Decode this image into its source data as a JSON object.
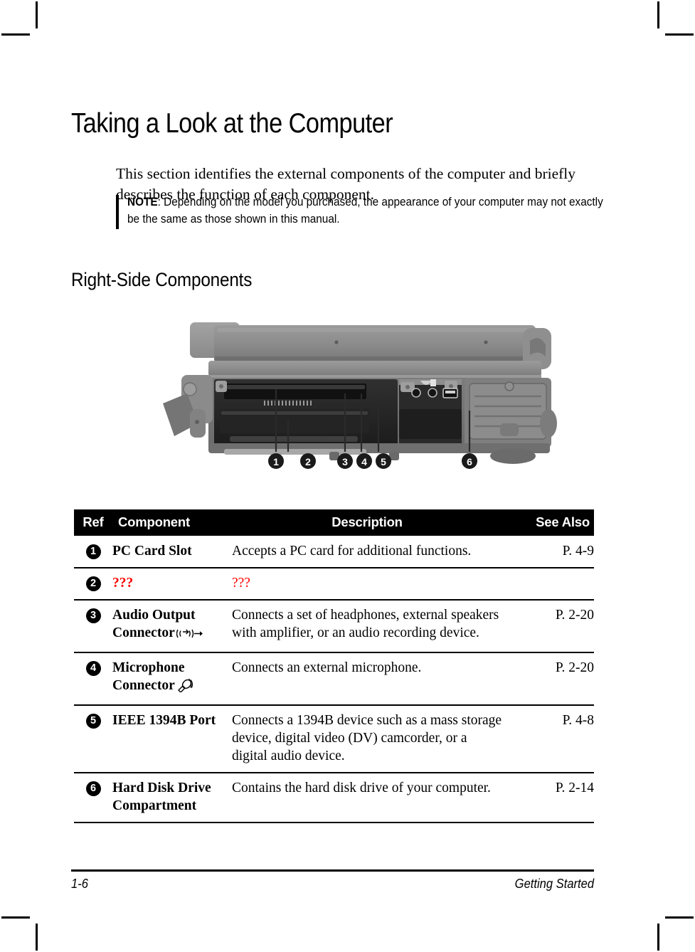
{
  "document": {
    "heading": "Taking a Look at the Computer",
    "intro": "This section identifies the external components of the computer and briefly describes the function of each component.",
    "note": {
      "label": "NOTE",
      "text": ": Depending on the model you purchased, the appearance of your computer may not exactly be the same as those shown in this manual."
    },
    "section_heading": "Right-Side Components"
  },
  "figure": {
    "alt": "Right-side view of a rugged notebook computer showing PC card slot, audio output connector, microphone connector, IEEE 1394B port and hard disk drive compartment",
    "callouts": [
      "1",
      "2",
      "3",
      "4",
      "5",
      "6"
    ],
    "body_color": "#8a8a8a",
    "shadow_color": "#5e5e5e",
    "dark_color": "#2e2e2e"
  },
  "table": {
    "headers": {
      "ref": "Ref",
      "component": "Component",
      "description": "Description",
      "see_also": "See Also"
    },
    "rows": [
      {
        "ref": "1",
        "component": "PC Card Slot",
        "icon": "",
        "description": "Accepts a PC card for additional functions.",
        "see_also": "P. 4-9",
        "missing": false
      },
      {
        "ref": "2",
        "component": "???",
        "icon": "",
        "description": "???",
        "see_also": "",
        "missing": true
      },
      {
        "ref": "3",
        "component": "Audio Output Connector",
        "icon": "audio-output-icon",
        "description": "Connects a set of headphones, external speakers with amplifier, or an audio recording device.",
        "see_also": "P. 2-20",
        "missing": false
      },
      {
        "ref": "4",
        "component": "Microphone Connector",
        "icon": "microphone-icon",
        "description": "Connects an external microphone.",
        "see_also": "P. 2-20",
        "missing": false
      },
      {
        "ref": "5",
        "component": "IEEE 1394B Port",
        "icon": "",
        "description": "Connects a 1394B device such as a mass storage device, digital video (DV) camcorder, or a digital audio device.",
        "see_also": "P. 4-8",
        "missing": false
      },
      {
        "ref": "6",
        "component": "Hard Disk Drive Compartment",
        "icon": "",
        "description": "Contains the hard disk drive of your computer.",
        "see_also": "P. 2-14",
        "missing": false
      }
    ]
  },
  "footer": {
    "page_number": "1-6",
    "chapter": "Getting Started"
  },
  "colors": {
    "header_bg": "#000000",
    "header_text": "#ffffff",
    "missing_text": "#ff0000",
    "body_text": "#000000"
  }
}
